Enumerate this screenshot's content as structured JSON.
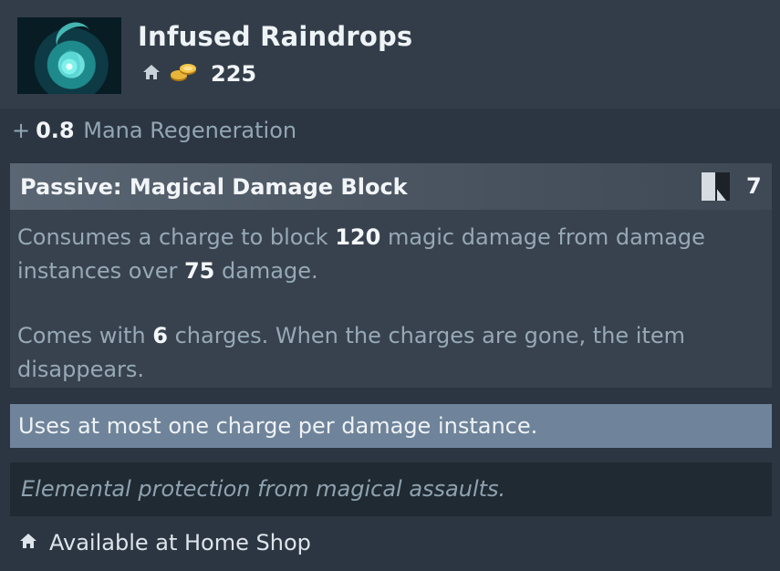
{
  "item": {
    "name": "Infused Raindrops",
    "icon": "raindrop-item-icon",
    "cost": "225"
  },
  "stats": [
    {
      "prefix": "+",
      "value": "0.8",
      "label": "Mana Regeneration"
    }
  ],
  "ability": {
    "title": "Passive: Magical Damage Block",
    "cooldown": "7",
    "desc1": {
      "t1": "Consumes a charge to block ",
      "v1": "120",
      "t2": " magic damage from damage instances over ",
      "v2": "75",
      "t3": " damage."
    },
    "desc2": {
      "t1": "Comes with ",
      "v1": "6",
      "t2": " charges. When the charges are gone, the item disappears."
    }
  },
  "note": "Uses at most one charge per damage instance.",
  "lore": "Elemental protection from magical assaults.",
  "availability": "Available at Home Shop",
  "colors": {
    "background": "#2c3542",
    "header": "#333d49",
    "note_bar": "#6f849a",
    "lore_bar": "#202a33",
    "highlight_text": "#f4f7f9",
    "body_text": "#97a9b6"
  }
}
